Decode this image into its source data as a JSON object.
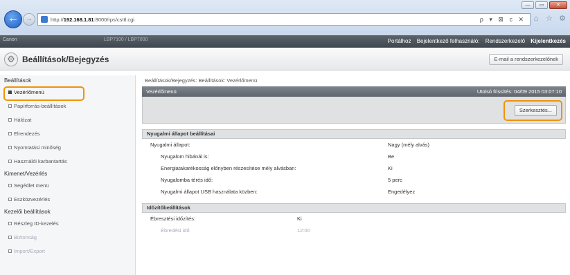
{
  "browser": {
    "url_prefix": "http://",
    "url_host": "192.168.1.81",
    "url_rest": ":8000/rps/csttl.cgi",
    "address_tools": "ρ ▾ ⊠ c ✕",
    "window_buttons": [
      "—",
      "▭",
      "✕"
    ],
    "icons": [
      "home-icon",
      "star-icon",
      "gear-icon"
    ]
  },
  "topbar": {
    "brand": "Canon",
    "model": "LBP7100 / LBP7000",
    "portal_link": "Portálhoz",
    "user_label": "Bejelentkező felhasználó:",
    "user_value": "Rendszerkezelő",
    "logout_link": "Kijelentkezés"
  },
  "title": {
    "page_title": "Beállítások/Bejegyzés",
    "email_button": "E-mail a rendszerkezelőnek"
  },
  "sidebar": {
    "sections": [
      {
        "heading": "Beállítások",
        "items": [
          "Vezérlőmenü",
          "Papírforrás-beállítások",
          "Hálózat",
          "Elrendezés",
          "Nyomtatási minőség",
          "Használói karbantartás"
        ]
      },
      {
        "heading": "Kimenet/Vezérlés",
        "items": [
          "Segédlet menü",
          "Eszközvezérlés"
        ]
      },
      {
        "heading": "Kezelői beállítások",
        "items": [
          "Részleg ID-kezelés",
          "Biztonság",
          "Import/Export"
        ]
      }
    ]
  },
  "main": {
    "breadcrumb": "Beállítások/Bejegyzés: Beállítások: Vezérlőmenü",
    "panel_title": "Vezérlőmenü",
    "last_updated": "Utolsó frissítés: 04/09 2015 03:07:10",
    "edit_button": "Szerkesztés...",
    "sleep_section": {
      "title": "Nyugalmi állapot beállításai",
      "rows": [
        {
          "label": "Nyugalmi állapot:",
          "value": "Nagy (mély alvás)"
        },
        {
          "label": "Nyugalom hibánál is:",
          "value": "Be"
        },
        {
          "label": "Energiatakarékosság előnyben részesítése mély alvásban:",
          "value": "Ki"
        },
        {
          "label": "Nyugalomba térés idő:",
          "value": "5 perc"
        },
        {
          "label": "Nyugalmi állapot USB használata közben:",
          "value": "Engedélyez"
        }
      ]
    },
    "timer_section": {
      "title": "Időzítőbeállítások",
      "rows": [
        {
          "label": "Ébresztési időzítés:",
          "value": "Ki"
        },
        {
          "label": "Ébredési idő",
          "value": "12:00"
        }
      ]
    }
  },
  "colors": {
    "highlight": "#f0930a",
    "topbar": "#4a5159",
    "panel_head": "#6e757c"
  }
}
